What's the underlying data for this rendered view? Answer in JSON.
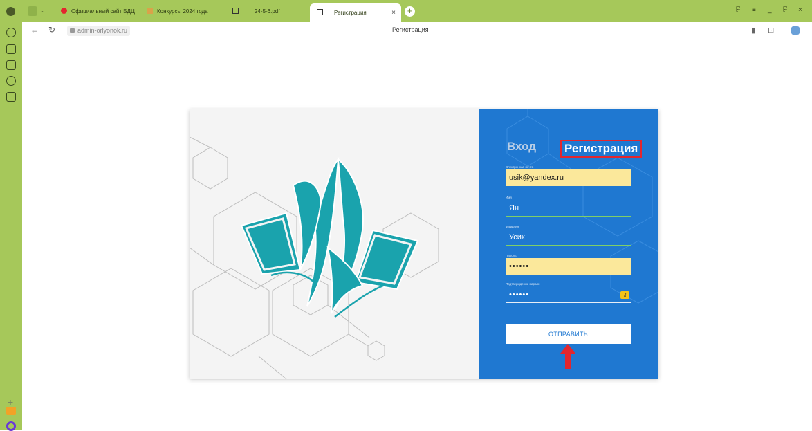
{
  "browser": {
    "tabs": [
      {
        "label": "Официальный сайт БДЦ"
      },
      {
        "label": "Конкурсы 2024 года"
      },
      {
        "label": "24-5-6.pdf"
      },
      {
        "label": "Регистрация",
        "active": true
      }
    ],
    "address": "admin-orlyonok.ru",
    "page_title": "Регистрация"
  },
  "form": {
    "tabs": {
      "login": "Вход",
      "register": "Регистрация"
    },
    "fields": {
      "email": {
        "label": "Электронная почта",
        "value": "usik@yandex.ru"
      },
      "first_name": {
        "label": "Имя",
        "value": "Ян"
      },
      "last_name": {
        "label": "Фамилия",
        "value": "Усик"
      },
      "password": {
        "label": "Пароль",
        "value": "••••••"
      },
      "password_confirm": {
        "label": "Подтверждение пароля",
        "value": "••••••"
      }
    },
    "submit_label": "ОТПРАВИТЬ"
  },
  "colors": {
    "browser_chrome": "#a6c85a",
    "panel_blue": "#1f78d1",
    "logo_teal": "#1aa3ad",
    "autofill_yellow": "#fbe89b",
    "highlight_red": "#e3262e"
  }
}
